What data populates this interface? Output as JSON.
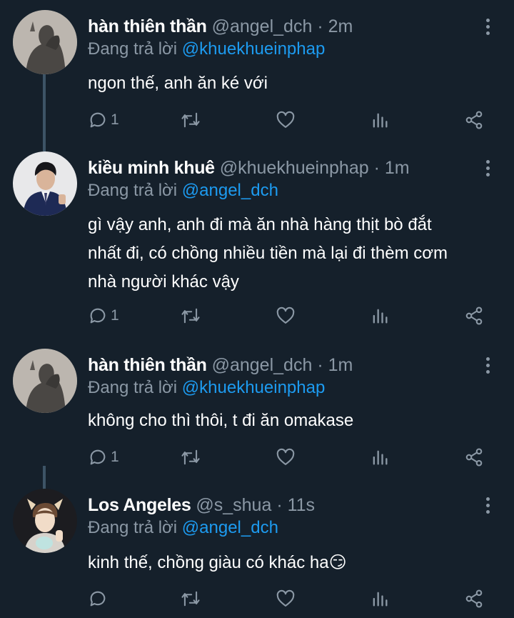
{
  "tweets": [
    {
      "name": "hàn thiên thần",
      "handle": "@angel_dch",
      "time": "· 2m",
      "reply_prefix": "Đang trả lời",
      "reply_to": "@khuekhueinphap",
      "lines": [
        "ngon thế, anh ăn ké với"
      ],
      "reply_count": "1",
      "avatar": "dark-gray-photo"
    },
    {
      "name": "kiều minh khuê",
      "handle": "@khuekhueinphap",
      "time": "· 1m",
      "reply_prefix": "Đang trả lời",
      "reply_to": "@angel_dch",
      "lines": [
        "gì vậy anh, anh đi mà ăn nhà hàng thịt bò đắt",
        "nhất đi, có chồng nhiều tiền mà lại đi thèm cơm",
        "nhà người khác vậy"
      ],
      "reply_count": "1",
      "avatar": "man-in-suit-photo"
    },
    {
      "name": "hàn thiên thần",
      "handle": "@angel_dch",
      "time": "· 1m",
      "reply_prefix": "Đang trả lời",
      "reply_to": "@khuekhueinphap",
      "lines": [
        "không cho thì thôi, t đi ăn omakase"
      ],
      "reply_count": "1",
      "avatar": "dark-gray-photo"
    },
    {
      "name": "Los Angeles",
      "handle": "@s_shua",
      "time": "· 11s",
      "reply_prefix": "Đang trả lời",
      "reply_to": "@angel_dch",
      "lines": [
        "kinh thế, chồng giàu có khác ha😏"
      ],
      "reply_count": "",
      "avatar": "person-with-antler-headband-photo"
    }
  ],
  "colors": {
    "background": "#15202b",
    "secondary_text": "#8b98a5",
    "mention": "#1d9bf0",
    "thread_line": "#3d5466"
  },
  "icons": [
    "reply-icon",
    "retweet-icon",
    "like-icon",
    "analytics-icon",
    "share-icon",
    "more-options-icon"
  ]
}
